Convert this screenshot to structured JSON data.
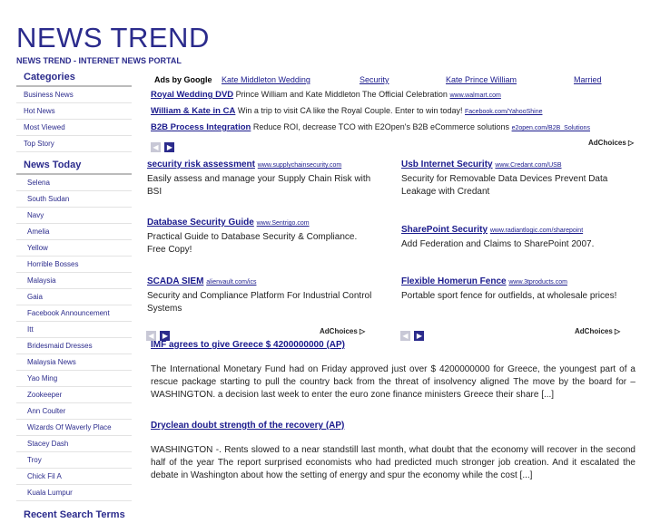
{
  "site": {
    "title": "NEWS TREND",
    "tagline": "NEWS TREND - INTERNET NEWS PORTAL"
  },
  "sidebar": {
    "categories_heading": "Categories",
    "categories": [
      "Business News",
      "Hot News",
      "Most Viewed",
      "Top Story"
    ],
    "today_heading": "News Today",
    "today": [
      "Selena",
      "South Sudan",
      "Navy",
      "Amelia",
      "Yellow",
      "Horrible Bosses",
      "Malaysia",
      "Gaia",
      "Facebook Announcement",
      "Itt",
      "Bridesmaid Dresses",
      "Malaysia News",
      "Yao Ming",
      "Zookeeper",
      "Ann Coulter",
      "Wizards Of Waverly Place",
      "Stacey Dash",
      "Troy",
      "Chick Fil A",
      "Kuala Lumpur"
    ],
    "recent_heading": "Recent Search Terms"
  },
  "ads_top": {
    "ads_by": "Ads by Google",
    "links": [
      "Kate Middleton Wedding",
      "Security",
      "Kate Prince William",
      "Married"
    ],
    "lines": [
      {
        "title": "Royal Wedding DVD",
        "text": "Prince William and Kate Middleton The Official Celebration",
        "url": "www.walmart.com"
      },
      {
        "title": "William & Kate in CA",
        "text": "Win a trip to visit CA like the Royal Couple. Enter to win today!",
        "url": "Facebook.com/YahooShine"
      },
      {
        "title": "B2B Process Integration",
        "text": "Reduce ROI, decrease TCO with E2Open's B2B eCommerce solutions",
        "url": "e2open.com/B2B_Solutions"
      }
    ],
    "adchoices": "AdChoices ▷"
  },
  "ads_grid": {
    "left": [
      {
        "title": "security risk assessment",
        "url": "www.supplychainsecurity.com",
        "text": "Easily assess and manage your Supply Chain Risk with BSI"
      },
      {
        "title": "Database Security Guide",
        "url": "www.Sentrigo.com",
        "text": "Practical Guide to Database Security & Compliance. Free Copy!"
      },
      {
        "title": "SCADA SIEM",
        "url": "alienvault.com/ics",
        "text": "Security and Compliance Platform For Industrial Control Systems"
      }
    ],
    "right": [
      {
        "title": "Usb Internet Security",
        "url": "www.Credant.com/USB",
        "text": "Security for Removable Data Devices Prevent Data Leakage with Credant"
      },
      {
        "title": "SharePoint Security",
        "url": "www.radiantlogic.com/sharepoint",
        "text": "Add Federation and Claims to SharePoint 2007."
      },
      {
        "title": "Flexible Homerun Fence",
        "url": "www.3tproducts.com",
        "text": "Portable sport fence for outfields, at wholesale prices!"
      }
    ],
    "adchoices": "AdChoices ▷"
  },
  "articles": [
    {
      "title": "IMF agrees to give Greece $ 4200000000 (AP)",
      "body": "The International Monetary Fund had on Friday approved just over $ 4200000000 for Greece, the youngest part of a rescue package starting to pull the country back from the threat of insolvency aligned The move by the board for – WASHINGTON. a decision last week to enter the euro zone finance ministers Greece their share [...]"
    },
    {
      "title": "Dryclean doubt strength of the recovery (AP)",
      "body": "WASHINGTON -. Rents slowed to a near standstill last month, what doubt that the economy will recover in the second half of the year The report surprised economists who had predicted much stronger job creation. And it escalated the debate in Washington about how the setting of energy and spur the economy while the cost [...]"
    }
  ],
  "nav": {
    "prev": "◀",
    "next": "▶"
  }
}
